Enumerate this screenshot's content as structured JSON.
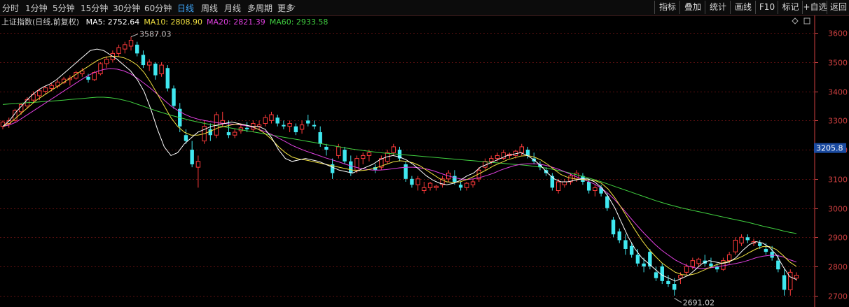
{
  "tabs": [
    {
      "label": "分时",
      "active": false
    },
    {
      "label": "1分钟",
      "active": false
    },
    {
      "label": "5分钟",
      "active": false
    },
    {
      "label": "15分钟",
      "active": false
    },
    {
      "label": "30分钟",
      "active": false
    },
    {
      "label": "60分钟",
      "active": false
    },
    {
      "label": "日线",
      "active": true
    },
    {
      "label": "周线",
      "active": false
    },
    {
      "label": "月线",
      "active": false
    },
    {
      "label": "多周期",
      "active": false
    },
    {
      "label": "更多",
      "active": false
    }
  ],
  "more_arrow": "▷",
  "toolbar": [
    {
      "label": "指标"
    },
    {
      "label": "叠加"
    },
    {
      "label": "统计"
    },
    {
      "label": "画线"
    },
    {
      "label": "F10"
    },
    {
      "label": "标记"
    },
    {
      "label": "+自选"
    },
    {
      "label": "返回"
    }
  ],
  "info": {
    "name": "上证指数(日线,前复权)",
    "ma_indicators": [
      {
        "label": "MA5: 2752.64",
        "color": "#ffffff"
      },
      {
        "label": "MA10: 2808.90",
        "color": "#f0e040"
      },
      {
        "label": "MA20: 2821.39",
        "color": "#e040e0"
      },
      {
        "label": "MA60: 2933.58",
        "color": "#40d040"
      }
    ]
  },
  "colors": {
    "up": "#ff3a3a",
    "down": "#40e8f0",
    "ma5": "#ffffff",
    "ma10": "#f0e040",
    "ma20": "#e040e0",
    "ma60": "#40d040",
    "grid": "#5a1010",
    "axis": "#d04040",
    "price_tag_bg": "#1a4aa0"
  },
  "chart_data": {
    "type": "candlestick",
    "y_ticks": [
      3600,
      3500,
      3400,
      3300,
      3200,
      3100,
      3000,
      2900,
      2800,
      2700
    ],
    "ylim": [
      2673,
      3622
    ],
    "current_price": "3205.8",
    "annotations": [
      {
        "label": "3587.03",
        "value": 3587.03,
        "anchor": "high"
      },
      {
        "label": "2691.02",
        "value": 2691.02,
        "anchor": "low"
      }
    ],
    "candles": [
      [
        3280,
        3300,
        3270,
        3295
      ],
      [
        3290,
        3310,
        3275,
        3300
      ],
      [
        3300,
        3340,
        3295,
        3335
      ],
      [
        3330,
        3360,
        3320,
        3355
      ],
      [
        3350,
        3380,
        3340,
        3372
      ],
      [
        3370,
        3400,
        3360,
        3390
      ],
      [
        3385,
        3410,
        3370,
        3402
      ],
      [
        3400,
        3420,
        3390,
        3412
      ],
      [
        3410,
        3430,
        3400,
        3420
      ],
      [
        3418,
        3440,
        3410,
        3432
      ],
      [
        3430,
        3450,
        3425,
        3442
      ],
      [
        3440,
        3455,
        3420,
        3445
      ],
      [
        3445,
        3470,
        3440,
        3465
      ],
      [
        3460,
        3480,
        3450,
        3470
      ],
      [
        3450,
        3460,
        3430,
        3440
      ],
      [
        3440,
        3470,
        3435,
        3465
      ],
      [
        3460,
        3500,
        3455,
        3495
      ],
      [
        3495,
        3520,
        3480,
        3510
      ],
      [
        3508,
        3540,
        3500,
        3530
      ],
      [
        3530,
        3560,
        3520,
        3550
      ],
      [
        3545,
        3570,
        3530,
        3560
      ],
      [
        3555,
        3587,
        3540,
        3575
      ],
      [
        3560,
        3570,
        3520,
        3530
      ],
      [
        3525,
        3540,
        3480,
        3490
      ],
      [
        3490,
        3510,
        3470,
        3500
      ],
      [
        3495,
        3500,
        3440,
        3455
      ],
      [
        3460,
        3500,
        3450,
        3490
      ],
      [
        3480,
        3490,
        3400,
        3410
      ],
      [
        3410,
        3420,
        3340,
        3350
      ],
      [
        3340,
        3360,
        3260,
        3280
      ],
      [
        3250,
        3270,
        3220,
        3230
      ],
      [
        3200,
        3230,
        3140,
        3150
      ],
      [
        3140,
        3180,
        3070,
        3160
      ],
      [
        3230,
        3300,
        3220,
        3280
      ],
      [
        3270,
        3290,
        3230,
        3250
      ],
      [
        3250,
        3330,
        3240,
        3320
      ],
      [
        3290,
        3330,
        3280,
        3300
      ],
      [
        3260,
        3300,
        3240,
        3250
      ],
      [
        3250,
        3270,
        3240,
        3260
      ],
      [
        3265,
        3290,
        3255,
        3275
      ],
      [
        3275,
        3295,
        3260,
        3270
      ],
      [
        3270,
        3300,
        3260,
        3290
      ],
      [
        3280,
        3300,
        3270,
        3285
      ],
      [
        3290,
        3320,
        3280,
        3310
      ],
      [
        3300,
        3330,
        3290,
        3320
      ],
      [
        3310,
        3320,
        3280,
        3290
      ],
      [
        3285,
        3300,
        3270,
        3280
      ],
      [
        3280,
        3300,
        3260,
        3290
      ],
      [
        3280,
        3290,
        3250,
        3260
      ],
      [
        3270,
        3300,
        3255,
        3285
      ],
      [
        3300,
        3320,
        3280,
        3290
      ],
      [
        3285,
        3300,
        3270,
        3280
      ],
      [
        3260,
        3280,
        3210,
        3220
      ],
      [
        3210,
        3220,
        3180,
        3200
      ],
      [
        3150,
        3170,
        3100,
        3120
      ],
      [
        3180,
        3220,
        3170,
        3210
      ],
      [
        3200,
        3210,
        3150,
        3160
      ],
      [
        3160,
        3180,
        3110,
        3120
      ],
      [
        3130,
        3180,
        3120,
        3170
      ],
      [
        3170,
        3190,
        3150,
        3180
      ],
      [
        3180,
        3200,
        3160,
        3190
      ],
      [
        3140,
        3150,
        3120,
        3130
      ],
      [
        3140,
        3180,
        3130,
        3170
      ],
      [
        3160,
        3200,
        3150,
        3190
      ],
      [
        3190,
        3220,
        3180,
        3210
      ],
      [
        3200,
        3210,
        3160,
        3170
      ],
      [
        3150,
        3160,
        3090,
        3100
      ],
      [
        3100,
        3110,
        3070,
        3080
      ],
      [
        3080,
        3110,
        3060,
        3100
      ],
      [
        3060,
        3090,
        3050,
        3070
      ],
      [
        3070,
        3090,
        3060,
        3085
      ],
      [
        3070,
        3080,
        3060,
        3075
      ],
      [
        3080,
        3110,
        3070,
        3100
      ],
      [
        3100,
        3130,
        3090,
        3120
      ],
      [
        3110,
        3130,
        3080,
        3090
      ],
      [
        3080,
        3090,
        3060,
        3070
      ],
      [
        3070,
        3090,
        3060,
        3085
      ],
      [
        3080,
        3100,
        3070,
        3090
      ],
      [
        3100,
        3140,
        3090,
        3130
      ],
      [
        3140,
        3170,
        3130,
        3160
      ],
      [
        3160,
        3180,
        3150,
        3170
      ],
      [
        3170,
        3190,
        3160,
        3180
      ],
      [
        3170,
        3200,
        3165,
        3190
      ],
      [
        3180,
        3190,
        3170,
        3185
      ],
      [
        3180,
        3200,
        3170,
        3195
      ],
      [
        3190,
        3220,
        3180,
        3210
      ],
      [
        3200,
        3210,
        3170,
        3180
      ],
      [
        3170,
        3190,
        3150,
        3160
      ],
      [
        3150,
        3160,
        3130,
        3140
      ],
      [
        3130,
        3140,
        3110,
        3120
      ],
      [
        3110,
        3120,
        3060,
        3070
      ],
      [
        3060,
        3100,
        3050,
        3090
      ],
      [
        3080,
        3100,
        3070,
        3090
      ],
      [
        3090,
        3120,
        3080,
        3110
      ],
      [
        3100,
        3130,
        3090,
        3120
      ],
      [
        3110,
        3120,
        3080,
        3090
      ],
      [
        3090,
        3100,
        3050,
        3060
      ],
      [
        3060,
        3080,
        3040,
        3070
      ],
      [
        3070,
        3080,
        3040,
        3050
      ],
      [
        3040,
        3050,
        2990,
        3000
      ],
      [
        2960,
        2970,
        2900,
        2910
      ],
      [
        2920,
        2930,
        2880,
        2890
      ],
      [
        2890,
        2910,
        2840,
        2860
      ],
      [
        2870,
        2880,
        2830,
        2840
      ],
      [
        2840,
        2860,
        2800,
        2810
      ],
      [
        2810,
        2830,
        2780,
        2800
      ],
      [
        2850,
        2860,
        2790,
        2800
      ],
      [
        2780,
        2800,
        2750,
        2760
      ],
      [
        2800,
        2810,
        2740,
        2750
      ],
      [
        2750,
        2770,
        2730,
        2740
      ],
      [
        2740,
        2760,
        2700,
        2720
      ],
      [
        2760,
        2780,
        2740,
        2770
      ],
      [
        2780,
        2810,
        2770,
        2800
      ],
      [
        2800,
        2830,
        2790,
        2820
      ],
      [
        2810,
        2830,
        2800,
        2825
      ],
      [
        2820,
        2840,
        2800,
        2810
      ],
      [
        2810,
        2830,
        2795,
        2800
      ],
      [
        2800,
        2810,
        2780,
        2790
      ],
      [
        2790,
        2830,
        2785,
        2820
      ],
      [
        2820,
        2850,
        2810,
        2840
      ],
      [
        2850,
        2900,
        2840,
        2890
      ],
      [
        2880,
        2910,
        2870,
        2900
      ],
      [
        2900,
        2910,
        2880,
        2890
      ],
      [
        2880,
        2895,
        2870,
        2885
      ],
      [
        2880,
        2890,
        2860,
        2870
      ],
      [
        2860,
        2880,
        2840,
        2850
      ],
      [
        2850,
        2870,
        2820,
        2830
      ],
      [
        2820,
        2840,
        2780,
        2790
      ],
      [
        2770,
        2790,
        2700,
        2720
      ],
      [
        2720,
        2790,
        2700,
        2780
      ],
      [
        2760,
        2780,
        2750,
        2770
      ]
    ],
    "ma5": [
      3280,
      3300,
      3330,
      3355,
      3380,
      3400,
      3415,
      3425,
      3440,
      3460,
      3480,
      3500,
      3520,
      3540,
      3545,
      3540,
      3525,
      3510,
      3490,
      3470,
      3440,
      3400,
      3340,
      3270,
      3210,
      3180,
      3190,
      3220,
      3240,
      3260,
      3270,
      3280,
      3285,
      3290,
      3295,
      3290,
      3285,
      3280,
      3280,
      3270,
      3240,
      3200,
      3170,
      3160,
      3165,
      3170,
      3165,
      3160,
      3150,
      3140,
      3130,
      3125,
      3120,
      3130,
      3140,
      3150,
      3165,
      3175,
      3180,
      3175,
      3165,
      3150,
      3130,
      3110,
      3095,
      3085,
      3080,
      3085,
      3095,
      3110,
      3120,
      3140,
      3150,
      3160,
      3170,
      3180,
      3185,
      3190,
      3180,
      3165,
      3145,
      3120,
      3100,
      3090,
      3090,
      3095,
      3100,
      3100,
      3090,
      3070,
      3040,
      3000,
      2950,
      2900,
      2860,
      2830,
      2810,
      2790,
      2770,
      2760,
      2750,
      2760,
      2770,
      2790,
      2810,
      2820,
      2815,
      2810,
      2815,
      2830,
      2855,
      2875,
      2885,
      2880,
      2865,
      2840,
      2800,
      2765,
      2755
    ],
    "ma10": [
      3280,
      3290,
      3310,
      3330,
      3350,
      3370,
      3385,
      3400,
      3415,
      3430,
      3445,
      3460,
      3475,
      3490,
      3505,
      3515,
      3520,
      3520,
      3515,
      3505,
      3490,
      3465,
      3430,
      3390,
      3350,
      3310,
      3280,
      3260,
      3250,
      3250,
      3255,
      3265,
      3275,
      3280,
      3285,
      3288,
      3285,
      3280,
      3270,
      3255,
      3235,
      3210,
      3190,
      3175,
      3168,
      3165,
      3160,
      3155,
      3150,
      3145,
      3140,
      3135,
      3130,
      3128,
      3130,
      3135,
      3142,
      3150,
      3158,
      3162,
      3160,
      3155,
      3145,
      3130,
      3115,
      3100,
      3090,
      3088,
      3090,
      3098,
      3108,
      3120,
      3132,
      3145,
      3155,
      3165,
      3172,
      3178,
      3180,
      3175,
      3165,
      3150,
      3132,
      3115,
      3105,
      3100,
      3098,
      3097,
      3095,
      3085,
      3065,
      3035,
      3000,
      2962,
      2925,
      2890,
      2860,
      2835,
      2812,
      2795,
      2780,
      2772,
      2770,
      2775,
      2785,
      2795,
      2805,
      2812,
      2818,
      2825,
      2835,
      2848,
      2860,
      2868,
      2868,
      2858,
      2838,
      2815,
      2800
    ],
    "ma20": [
      3280,
      3285,
      3295,
      3310,
      3325,
      3340,
      3355,
      3370,
      3385,
      3400,
      3415,
      3430,
      3445,
      3458,
      3468,
      3475,
      3478,
      3476,
      3470,
      3460,
      3445,
      3428,
      3410,
      3390,
      3370,
      3350,
      3335,
      3322,
      3312,
      3305,
      3300,
      3296,
      3292,
      3290,
      3288,
      3286,
      3283,
      3278,
      3270,
      3262,
      3252,
      3240,
      3228,
      3215,
      3205,
      3196,
      3188,
      3180,
      3172,
      3165,
      3158,
      3150,
      3143,
      3137,
      3133,
      3130,
      3130,
      3132,
      3135,
      3138,
      3140,
      3140,
      3138,
      3134,
      3128,
      3120,
      3112,
      3105,
      3100,
      3098,
      3100,
      3105,
      3112,
      3120,
      3130,
      3138,
      3145,
      3150,
      3152,
      3152,
      3150,
      3145,
      3138,
      3130,
      3120,
      3110,
      3100,
      3092,
      3082,
      3068,
      3050,
      3028,
      3002,
      2975,
      2948,
      2922,
      2898,
      2875,
      2855,
      2838,
      2822,
      2810,
      2800,
      2795,
      2793,
      2795,
      2798,
      2802,
      2806,
      2810,
      2815,
      2822,
      2830,
      2835,
      2838,
      2838,
      2833,
      2823,
      2815
    ],
    "ma60": [
      3355,
      3357,
      3358,
      3360,
      3362,
      3363,
      3365,
      3366,
      3368,
      3370,
      3372,
      3374,
      3376,
      3378,
      3380,
      3380,
      3378,
      3375,
      3370,
      3364,
      3356,
      3348,
      3340,
      3332,
      3325,
      3318,
      3312,
      3306,
      3300,
      3295,
      3290,
      3286,
      3282,
      3278,
      3274,
      3270,
      3266,
      3262,
      3258,
      3254,
      3250,
      3246,
      3242,
      3238,
      3234,
      3230,
      3226,
      3222,
      3218,
      3214,
      3210,
      3206,
      3202,
      3199,
      3196,
      3193,
      3190,
      3188,
      3186,
      3184,
      3182,
      3180,
      3178,
      3176,
      3174,
      3172,
      3170,
      3168,
      3166,
      3164,
      3162,
      3160,
      3158,
      3156,
      3154,
      3152,
      3150,
      3148,
      3146,
      3143,
      3140,
      3136,
      3132,
      3127,
      3122,
      3116,
      3110,
      3104,
      3097,
      3090,
      3082,
      3074,
      3066,
      3058,
      3050,
      3042,
      3034,
      3026,
      3019,
      3012,
      3006,
      3000,
      2995,
      2990,
      2985,
      2980,
      2975,
      2970,
      2965,
      2960,
      2955,
      2950,
      2944,
      2938,
      2933,
      2928,
      2922,
      2917,
      2913
    ]
  }
}
